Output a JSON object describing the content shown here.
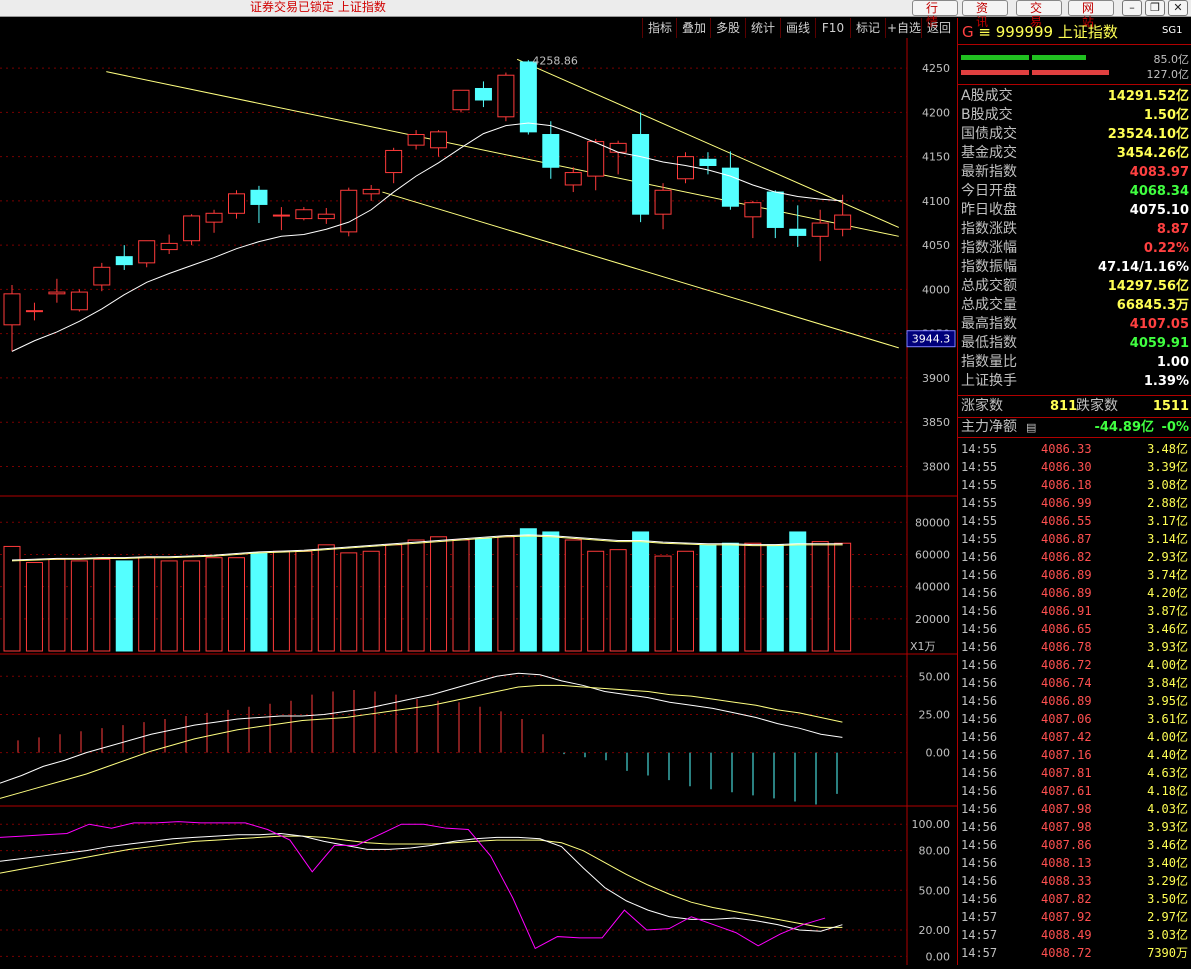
{
  "window": {
    "title": "证券交易已锁定 上证指数",
    "top_buttons": [
      "行 情",
      "资 讯",
      "交 易",
      "网 站"
    ],
    "window_controls": [
      "?",
      "minimize-icon",
      "restore-icon",
      "close-icon"
    ]
  },
  "toolbar": {
    "items": [
      "指标",
      "叠加",
      "多股",
      "统计",
      "画线",
      "F10",
      "标记",
      "+自选",
      "返回"
    ]
  },
  "colors": {
    "up": "#ff3b3b",
    "down": "#54ffff",
    "ma": "#ffffff",
    "ma2": "#ffff80",
    "trend": "#ffff80",
    "kdj_j": "#ff00ff",
    "grid": "#7a0000",
    "axis_text": "#c0c0c0"
  },
  "quote": {
    "prefix": "G",
    "code": "999999",
    "name": "上证指数",
    "tag": "SG1",
    "bar1_label": "85.0亿",
    "bar2_label": "127.0亿",
    "fields": [
      {
        "label": "A股成交",
        "value": "14291.52亿",
        "color": "#ffff54"
      },
      {
        "label": "B股成交",
        "value": "1.50亿",
        "color": "#ffff54"
      },
      {
        "label": "国债成交",
        "value": "23524.10亿",
        "color": "#ffff54"
      },
      {
        "label": "基金成交",
        "value": "3454.26亿",
        "color": "#ffff54"
      },
      {
        "label": "最新指数",
        "value": "4083.97",
        "color": "#ff4040"
      },
      {
        "label": "今日开盘",
        "value": "4068.34",
        "color": "#40ff40"
      },
      {
        "label": "昨日收盘",
        "value": "4075.10",
        "color": "#ffffff"
      },
      {
        "label": "指数涨跌",
        "value": "8.87",
        "color": "#ff4040"
      },
      {
        "label": "指数涨幅",
        "value": "0.22%",
        "color": "#ff4040"
      },
      {
        "label": "指数振幅",
        "value": "47.14/1.16%",
        "color": "#ffffff"
      },
      {
        "label": "总成交额",
        "value": "14297.56亿",
        "color": "#ffff54"
      },
      {
        "label": "总成交量",
        "value": "66845.3万",
        "color": "#ffff54"
      },
      {
        "label": "最高指数",
        "value": "4107.05",
        "color": "#ff4040"
      },
      {
        "label": "最低指数",
        "value": "4059.91",
        "color": "#40ff40"
      },
      {
        "label": "指数量比",
        "value": "1.00",
        "color": "#ffffff"
      },
      {
        "label": "上证换手",
        "value": "1.39%",
        "color": "#ffffff"
      }
    ],
    "advance_label": "涨家数",
    "advance_value": "811",
    "decline_label": "跌家数",
    "decline_value": "1511",
    "mainflow_label": "主力净额",
    "mainflow_value": "-44.89亿",
    "mainflow_pct": "-0%"
  },
  "ticks": [
    {
      "time": "14:55",
      "price": "4086.33",
      "amount": "3.48亿"
    },
    {
      "time": "14:55",
      "price": "4086.30",
      "amount": "3.39亿"
    },
    {
      "time": "14:55",
      "price": "4086.18",
      "amount": "3.08亿"
    },
    {
      "time": "14:55",
      "price": "4086.99",
      "amount": "2.88亿"
    },
    {
      "time": "14:55",
      "price": "4086.55",
      "amount": "3.17亿"
    },
    {
      "time": "14:55",
      "price": "4086.87",
      "amount": "3.14亿"
    },
    {
      "time": "14:56",
      "price": "4086.82",
      "amount": "2.93亿"
    },
    {
      "time": "14:56",
      "price": "4086.89",
      "amount": "3.74亿"
    },
    {
      "time": "14:56",
      "price": "4086.89",
      "amount": "4.20亿"
    },
    {
      "time": "14:56",
      "price": "4086.91",
      "amount": "3.87亿"
    },
    {
      "time": "14:56",
      "price": "4086.65",
      "amount": "3.46亿"
    },
    {
      "time": "14:56",
      "price": "4086.78",
      "amount": "3.93亿"
    },
    {
      "time": "14:56",
      "price": "4086.72",
      "amount": "4.00亿"
    },
    {
      "time": "14:56",
      "price": "4086.74",
      "amount": "3.84亿"
    },
    {
      "time": "14:56",
      "price": "4086.89",
      "amount": "3.95亿"
    },
    {
      "time": "14:56",
      "price": "4087.06",
      "amount": "3.61亿"
    },
    {
      "time": "14:56",
      "price": "4087.42",
      "amount": "4.00亿"
    },
    {
      "time": "14:56",
      "price": "4087.16",
      "amount": "4.40亿"
    },
    {
      "time": "14:56",
      "price": "4087.81",
      "amount": "4.63亿"
    },
    {
      "time": "14:56",
      "price": "4087.61",
      "amount": "4.18亿"
    },
    {
      "time": "14:56",
      "price": "4087.98",
      "amount": "4.03亿"
    },
    {
      "time": "14:56",
      "price": "4087.98",
      "amount": "3.93亿"
    },
    {
      "time": "14:56",
      "price": "4087.86",
      "amount": "3.46亿"
    },
    {
      "time": "14:56",
      "price": "4088.13",
      "amount": "3.40亿"
    },
    {
      "time": "14:56",
      "price": "4088.33",
      "amount": "3.29亿"
    },
    {
      "time": "14:56",
      "price": "4087.82",
      "amount": "3.50亿"
    },
    {
      "time": "14:57",
      "price": "4087.92",
      "amount": "2.97亿"
    },
    {
      "time": "14:57",
      "price": "4088.49",
      "amount": "3.03亿"
    },
    {
      "time": "14:57",
      "price": "4088.72",
      "amount": "7390万"
    }
  ],
  "chart_data": [
    {
      "type": "candlestick",
      "yticks": [
        "4250",
        "4200",
        "4150",
        "4100",
        "4050",
        "4000",
        "3950",
        "3900",
        "3850",
        "3800"
      ],
      "ylim": [
        3770,
        4275
      ],
      "crosshair_value": "3944.3",
      "peak_label": "4258.86",
      "candles": [
        {
          "o": 3960,
          "h": 4005,
          "l": 3930,
          "c": 3995
        },
        {
          "o": 3976,
          "h": 3985,
          "l": 3965,
          "c": 3976
        },
        {
          "o": 3995,
          "h": 4012,
          "l": 3985,
          "c": 3997
        },
        {
          "o": 3977,
          "h": 4000,
          "l": 3975,
          "c": 3997
        },
        {
          "o": 4005,
          "h": 4030,
          "l": 3998,
          "c": 4025
        },
        {
          "o": 4037,
          "h": 4050,
          "l": 4022,
          "c": 4028
        },
        {
          "o": 4030,
          "h": 4055,
          "l": 4025,
          "c": 4055
        },
        {
          "o": 4045,
          "h": 4062,
          "l": 4040,
          "c": 4052
        },
        {
          "o": 4055,
          "h": 4085,
          "l": 4050,
          "c": 4083
        },
        {
          "o": 4076,
          "h": 4090,
          "l": 4064,
          "c": 4086
        },
        {
          "o": 4086,
          "h": 4112,
          "l": 4080,
          "c": 4108
        },
        {
          "o": 4112,
          "h": 4117,
          "l": 4075,
          "c": 4096
        },
        {
          "o": 4084,
          "h": 4093,
          "l": 4067,
          "c": 4084
        },
        {
          "o": 4080,
          "h": 4093,
          "l": 4078,
          "c": 4090
        },
        {
          "o": 4080,
          "h": 4092,
          "l": 4074,
          "c": 4085
        },
        {
          "o": 4065,
          "h": 4115,
          "l": 4060,
          "c": 4112
        },
        {
          "o": 4108,
          "h": 4118,
          "l": 4100,
          "c": 4113
        },
        {
          "o": 4132,
          "h": 4160,
          "l": 4120,
          "c": 4157
        },
        {
          "o": 4163,
          "h": 4180,
          "l": 4158,
          "c": 4175
        },
        {
          "o": 4160,
          "h": 4180,
          "l": 4150,
          "c": 4178
        },
        {
          "o": 4203,
          "h": 4225,
          "l": 4200,
          "c": 4225
        },
        {
          "o": 4227,
          "h": 4235,
          "l": 4206,
          "c": 4214
        },
        {
          "o": 4195,
          "h": 4245,
          "l": 4190,
          "c": 4242
        },
        {
          "o": 4257,
          "h": 4259,
          "l": 4175,
          "c": 4178
        },
        {
          "o": 4175,
          "h": 4190,
          "l": 4125,
          "c": 4138
        },
        {
          "o": 4118,
          "h": 4138,
          "l": 4110,
          "c": 4132
        },
        {
          "o": 4128,
          "h": 4170,
          "l": 4112,
          "c": 4167
        },
        {
          "o": 4155,
          "h": 4168,
          "l": 4130,
          "c": 4165
        },
        {
          "o": 4175,
          "h": 4200,
          "l": 4076,
          "c": 4085
        },
        {
          "o": 4085,
          "h": 4120,
          "l": 4068,
          "c": 4112
        },
        {
          "o": 4125,
          "h": 4155,
          "l": 4120,
          "c": 4150
        },
        {
          "o": 4147,
          "h": 4155,
          "l": 4130,
          "c": 4140
        },
        {
          "o": 4137,
          "h": 4156,
          "l": 4090,
          "c": 4094
        },
        {
          "o": 4082,
          "h": 4100,
          "l": 4058,
          "c": 4098
        },
        {
          "o": 4110,
          "h": 4112,
          "l": 4058,
          "c": 4070
        },
        {
          "o": 4068,
          "h": 4095,
          "l": 4048,
          "c": 4061
        },
        {
          "o": 4060,
          "h": 4090,
          "l": 4032,
          "c": 4075
        },
        {
          "o": 4068,
          "h": 4107,
          "l": 4060,
          "c": 4084
        }
      ],
      "ma": [
        3930,
        3942,
        3952,
        3964,
        3978,
        3994,
        4008,
        4018,
        4027,
        4036,
        4046,
        4054,
        4060,
        4062,
        4068,
        4076,
        4090,
        4110,
        4128,
        4143,
        4160,
        4176,
        4185,
        4188,
        4185,
        4176,
        4166,
        4155,
        4150,
        4144,
        4140,
        4135,
        4128,
        4118,
        4110,
        4105,
        4102,
        4100
      ],
      "trendlines": [
        {
          "x1": 4.2,
          "y1": 4246,
          "x2": 39.5,
          "y2": 4060
        },
        {
          "x1": 22.5,
          "y1": 4260,
          "x2": 39.5,
          "y2": 4070
        },
        {
          "x1": 16.5,
          "y1": 4110,
          "x2": 39.5,
          "y2": 3934
        }
      ]
    },
    {
      "type": "bar",
      "unit": "X1万",
      "yticks": [
        "80000",
        "60000",
        "40000",
        "20000"
      ],
      "ylim": [
        0,
        92000
      ],
      "volumes": [
        65000,
        55000,
        57000,
        56000,
        57000,
        56000,
        58000,
        56000,
        56000,
        58000,
        58000,
        61000,
        62000,
        62000,
        66000,
        61000,
        62000,
        66000,
        69000,
        71000,
        69000,
        70000,
        71000,
        76000,
        74000,
        69000,
        62000,
        63000,
        74000,
        59000,
        62000,
        66000,
        67000,
        67000,
        66000,
        74000,
        68000,
        67000
      ],
      "vol_ma": [
        56000,
        56500,
        57000,
        57000,
        57500,
        57500,
        58000,
        58000,
        58500,
        59000,
        60000,
        61000,
        61500,
        62000,
        63000,
        64000,
        65000,
        66000,
        67000,
        68000,
        69000,
        70000,
        71000,
        71500,
        71000,
        70000,
        69000,
        68000,
        68000,
        67000,
        66500,
        66000,
        66000,
        65500,
        65500,
        66000,
        66000,
        66000
      ]
    },
    {
      "type": "bar",
      "name": "MACD",
      "yticks": [
        "50.00",
        "25.00",
        "0.00"
      ],
      "ylim": [
        -33,
        60
      ],
      "hist": [
        8,
        10,
        12,
        14,
        16,
        18,
        20,
        22,
        24,
        26,
        28,
        30,
        32,
        34,
        38,
        40,
        41,
        40,
        38,
        35,
        34,
        33,
        30,
        27,
        22,
        12,
        -1,
        -3,
        -5,
        -12,
        -15,
        -18,
        -22,
        -24,
        -26,
        -28,
        -30,
        -32,
        -34,
        -27
      ],
      "dif": [
        -20,
        -15,
        -9,
        -5,
        0,
        4,
        8,
        12,
        15,
        18,
        20,
        22,
        23,
        24,
        24,
        25,
        27,
        29,
        32,
        35,
        38,
        42,
        46,
        50,
        52,
        51,
        47,
        44,
        40,
        38,
        36,
        33,
        31,
        29,
        26,
        23,
        19,
        16,
        12,
        10
      ],
      "dea": [
        -30,
        -26,
        -22,
        -18,
        -14,
        -9,
        -4,
        1,
        5,
        9,
        12,
        15,
        17,
        19,
        21,
        22,
        23,
        25,
        27,
        29,
        31,
        34,
        37,
        40,
        43,
        44,
        44,
        43,
        42,
        41,
        40,
        38,
        37,
        35,
        33,
        31,
        28,
        26,
        23,
        20
      ]
    },
    {
      "type": "line",
      "name": "KDJ",
      "yticks": [
        "100.00",
        "80.00",
        "50.00",
        "20.00",
        "0.00"
      ],
      "ylim": [
        -5,
        110
      ],
      "k": [
        72,
        74,
        76,
        78,
        80,
        83,
        85,
        87,
        89,
        90,
        91,
        92,
        92,
        93,
        91,
        87,
        84,
        81,
        81,
        82,
        84,
        87,
        89,
        90,
        90,
        89,
        83,
        67,
        52,
        42,
        35,
        30,
        28,
        28,
        29,
        27,
        24,
        20,
        19,
        24
      ],
      "d": [
        63,
        66,
        69,
        72,
        75,
        78,
        81,
        83,
        85,
        87,
        88,
        89,
        90,
        91,
        91,
        90,
        88,
        86,
        85,
        85,
        85,
        86,
        87,
        88,
        88,
        88,
        86,
        80,
        71,
        62,
        54,
        47,
        41,
        37,
        34,
        31,
        28,
        25,
        22,
        22
      ],
      "j": [
        90,
        91,
        92,
        93,
        100,
        97,
        101,
        101,
        102,
        101,
        101,
        101,
        96,
        88,
        64,
        84,
        84,
        92,
        100,
        100,
        97,
        96,
        76,
        44,
        6,
        15,
        14,
        14,
        35,
        20,
        21,
        30,
        24,
        18,
        8,
        17,
        24,
        29
      ]
    }
  ]
}
